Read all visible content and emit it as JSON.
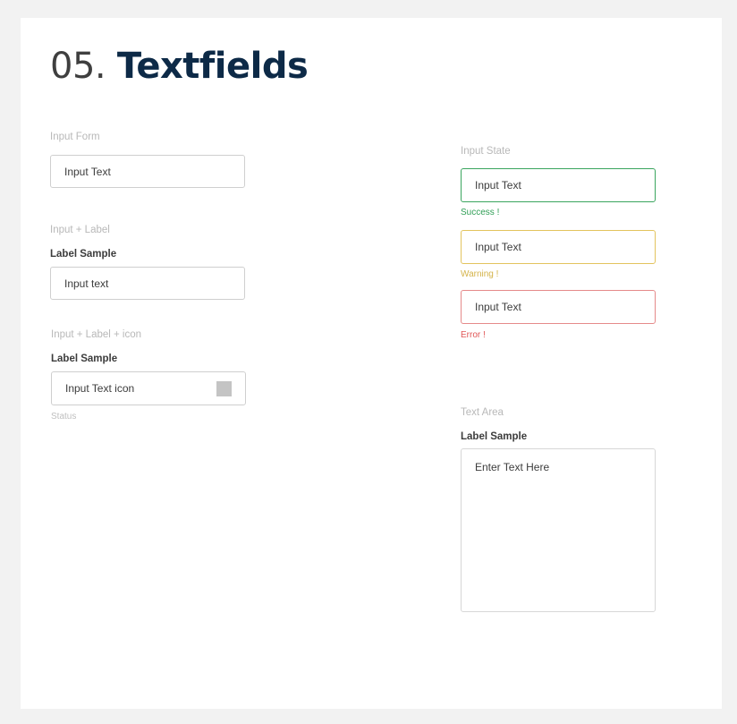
{
  "page": {
    "title_number": "05.",
    "title_text": "Textfields"
  },
  "input_form": {
    "section_label": "Input Form",
    "value": "Input Text"
  },
  "input_label": {
    "section_label": "Input  + Label",
    "field_label": "Label Sample",
    "value": "Input text"
  },
  "input_label_icon": {
    "section_label": "Input + Label + icon",
    "field_label": "Label Sample",
    "value": "Input Text icon",
    "icon": "placeholder-square-icon",
    "status": "Status"
  },
  "input_state": {
    "section_label": "Input State",
    "success": {
      "value": "Input Text",
      "message": "Success !",
      "color": "#3aa55e"
    },
    "warning": {
      "value": "Input Text",
      "message": "Warning !",
      "color": "#e3c45e"
    },
    "error": {
      "value": "Input Text",
      "message": "Error !",
      "color": "#e58a8a"
    }
  },
  "text_area": {
    "section_label": "Text Area",
    "field_label": "Label Sample",
    "placeholder": "Enter Text Here"
  }
}
